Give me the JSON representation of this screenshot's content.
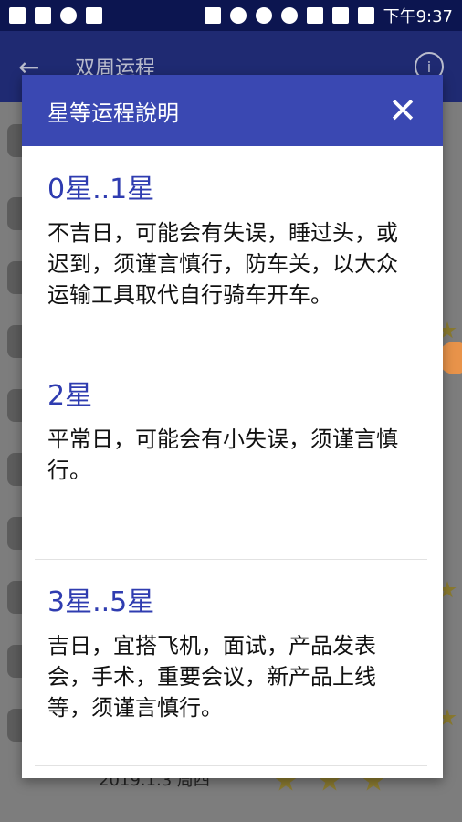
{
  "status_bar": {
    "time": "下午9:37",
    "left_icons": [
      "facebook-icon",
      "video-icon",
      "alarm-icon",
      "image-icon"
    ],
    "right_icons": [
      "cast-icon",
      "bluetooth-icon",
      "dnd-icon",
      "alarm-icon",
      "wifi-icon",
      "signal-icon",
      "battery-icon"
    ]
  },
  "app_bar": {
    "title": "双周运程",
    "info_label": "i"
  },
  "background": {
    "bottom_row_date": "2019.1.3 周四"
  },
  "dialog": {
    "title": "星等运程說明",
    "close_label": "✕",
    "sections": [
      {
        "title": "0星..1星",
        "body": "不吉日，可能会有失误，睡过头，或迟到，须谨言慎行，防车关，以大众运输工具取代自行骑车开车。"
      },
      {
        "title": "2星",
        "body": "平常日，可能会有小失误，须谨言慎行。"
      },
      {
        "title": "3星..5星",
        "body": "吉日，宜搭飞机，面试，产品发表会，手术，重要会议，新产品上线等，须谨言慎行。"
      }
    ]
  },
  "colors": {
    "status_bar": "#0c1550",
    "app_bar": "#1f2a72",
    "dialog_header": "#3a48b2",
    "section_title": "#2f3cb0"
  }
}
